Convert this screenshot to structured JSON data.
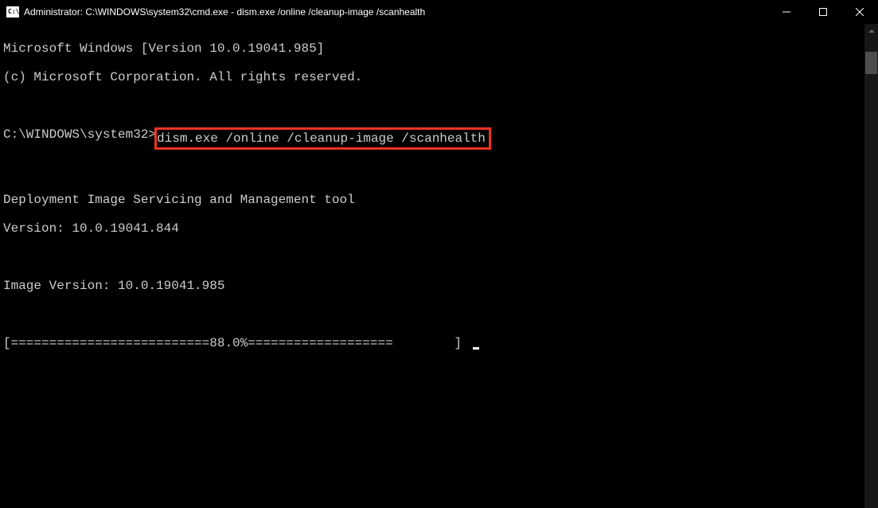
{
  "window": {
    "title": "Administrator: C:\\WINDOWS\\system32\\cmd.exe - dism.exe  /online /cleanup-image /scanhealth"
  },
  "terminal": {
    "line1": "Microsoft Windows [Version 10.0.19041.985]",
    "line2": "(c) Microsoft Corporation. All rights reserved.",
    "prompt": "C:\\WINDOWS\\system32>",
    "command": "dism.exe /online /cleanup-image /scanhealth",
    "tool_line1": "Deployment Image Servicing and Management tool",
    "tool_line2": "Version: 10.0.19041.844",
    "image_version": "Image Version: 10.0.19041.985",
    "progress": "[==========================88.0%===================        ] "
  }
}
